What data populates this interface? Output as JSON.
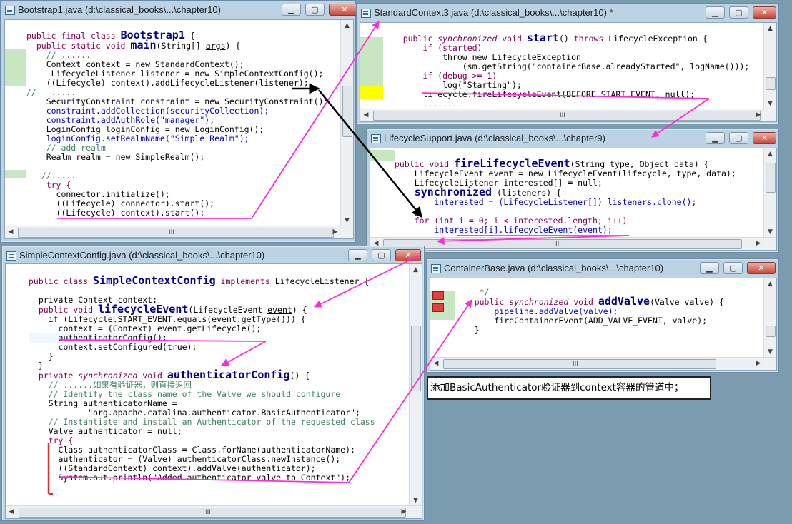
{
  "windows": {
    "bootstrap": {
      "title": "Bootstrap1.java (d:\\classical_books\\...\\chapter10)",
      "lines": [
        "public final class Bootstrap1 {",
        "  public static void main(String[] args) {",
        "    // ......",
        "    Context context = new StandardContext();",
        "     LifecycleListener listener = new SimpleContextConfig();",
        "    ((Lifecycle) context).addLifecycleListener(listener);",
        "//   .....",
        "    SecurityConstraint constraint = new SecurityConstraint();",
        "    constraint.addCollection(securityCollection);",
        "    constraint.addAuthRole(\"manager\");",
        "    LoginConfig loginConfig = new LoginConfig();",
        "    loginConfig.setRealmName(\"Simple Realm\");",
        "    // add realm",
        "    Realm realm = new SimpleRealm();",
        "",
        "   //.....",
        "    try {",
        "      connector.initialize();",
        "      ((Lifecycle) connector).start();",
        "      ((Lifecycle) context).start();"
      ]
    },
    "standardContext": {
      "title": "StandardContext3.java (d:\\classical_books\\...\\chapter10) *",
      "lines": [
        "    public synchronized void start() throws LifecycleException {",
        "        if (started)",
        "            throw new LifecycleException",
        "                (sm.getString(\"containerBase.alreadyStarted\", logName()));",
        "        if (debug >= 1)",
        "            log(\"Starting\");",
        "        lifecycle.fireLifecycleEvent(BEFORE_START_EVENT, null);",
        "        ........"
      ]
    },
    "lifecycleSupport": {
      "title": "LifecycleSupport.java (d:\\classical_books\\...\\chapter9)",
      "lines": [
        "public void fireLifecycleEvent(String type, Object data) {",
        "    LifecycleEvent event = new LifecycleEvent(lifecycle, type, data);",
        "    LifecycleListener interested[] = null;",
        "    synchronized (listeners) {",
        "        interested = (LifecycleListener[]) listeners.clone();",
        "    }",
        "    for (int i = 0; i < interested.length; i++)",
        "        interested[i].lifecycleEvent(event);"
      ]
    },
    "simpleContextConfig": {
      "title": "SimpleContextConfig.java (d:\\classical_books\\...\\chapter10)",
      "lines": [
        "public class SimpleContextConfig implements LifecycleListener {",
        "",
        "  private Context context;",
        "  public void lifecycleEvent(LifecycleEvent event) {",
        "    if (Lifecycle.START_EVENT.equals(event.getType())) {",
        "      context = (Context) event.getLifecycle();",
        "      authenticatorConfig();",
        "      context.setConfigured(true);",
        "    }",
        "  }",
        "  private synchronized void authenticatorConfig() {",
        "    // ......如果有验证器，则直接返回",
        "    // Identify the class name of the Valve we should configure",
        "    String authenticatorName =",
        "            \"org.apache.catalina.authenticator.BasicAuthenticator\";",
        "    // Instantiate and install an Authenticator of the requested class",
        "    Valve authenticator = null;",
        "    try {",
        "      Class authenticatorClass = Class.forName(authenticatorName);",
        "      authenticator = (Valve) authenticatorClass.newInstance();",
        "      ((StandardContext) context).addValve(authenticator);",
        "      System.out.println(\"Added authenticator valve to Context\");"
      ]
    },
    "containerBase": {
      "title": "ContainerBase.java (d:\\classical_books\\...\\chapter10)",
      "lines": [
        "     */",
        "    public synchronized void addValve(Valve valve) {",
        "        pipeline.addValve(valve);",
        "        fireContainerEvent(ADD_VALVE_EVENT, valve);",
        "    }"
      ]
    }
  },
  "note": "添加BasicAuthenticator验证器到context容器的管道中；",
  "scroll_grip": "III",
  "colors": {
    "arrow": "#ff2bd9",
    "black_arrow": "#000000",
    "marker_green": "#c8e6c0",
    "marker_yellow": "#ffff00",
    "red_bracket": "#e0302a"
  }
}
